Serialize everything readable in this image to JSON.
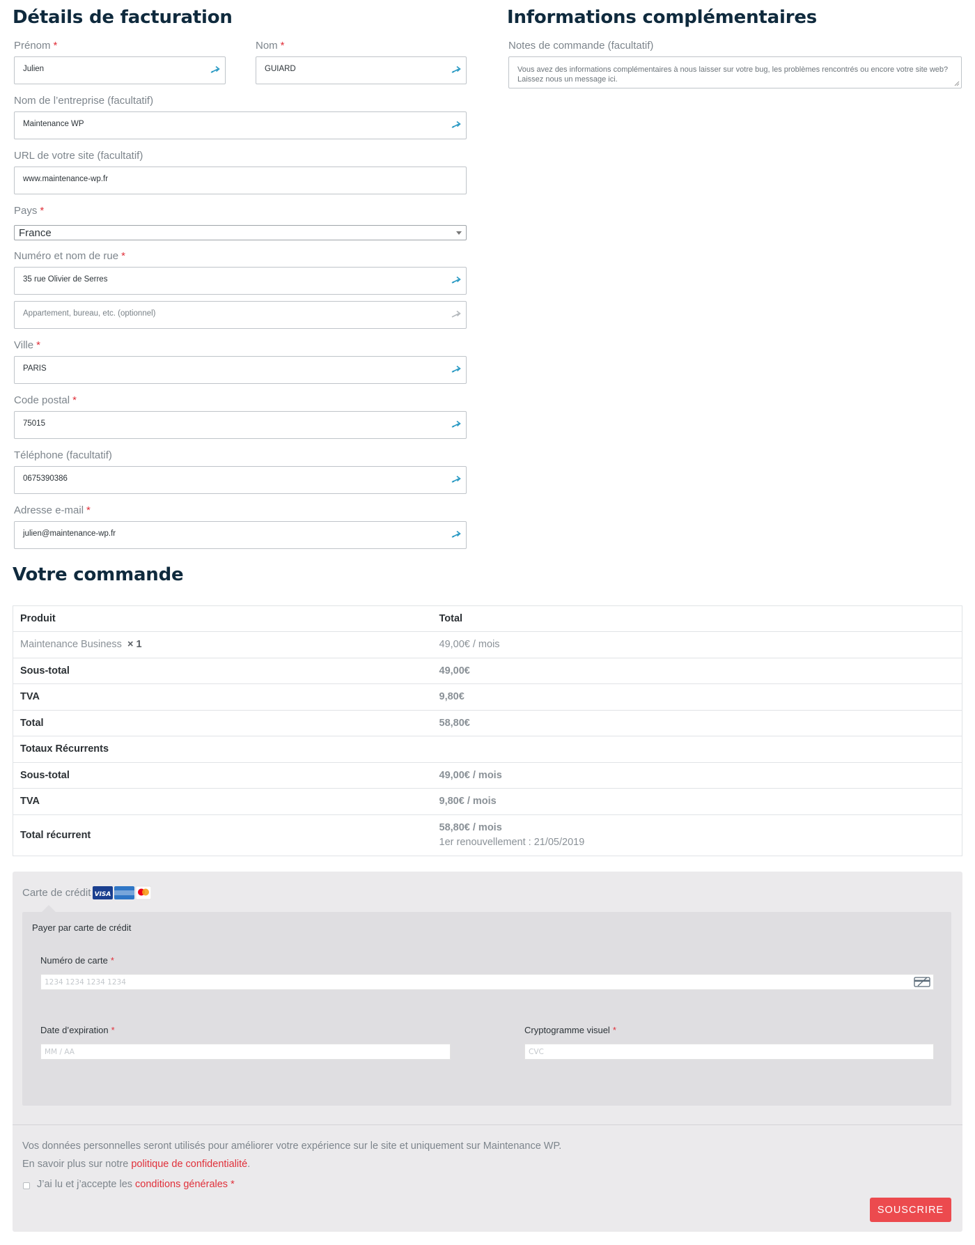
{
  "billing": {
    "title": "Détails de facturation",
    "first_name": {
      "label": "Prénom",
      "required": "*",
      "value": "Julien"
    },
    "last_name": {
      "label": "Nom",
      "required": "*",
      "value": "GUIARD"
    },
    "company": {
      "label": "Nom de l’entreprise (facultatif)",
      "value": "Maintenance WP"
    },
    "site_url": {
      "label": "URL de votre site (facultatif)",
      "value": "www.maintenance-wp.fr"
    },
    "country": {
      "label": "Pays",
      "required": "*",
      "value": "France"
    },
    "street": {
      "label": "Numéro et nom de rue",
      "required": "*",
      "value": "35 rue Olivier de Serres",
      "placeholder2": "Appartement, bureau, etc. (optionnel)"
    },
    "city": {
      "label": "Ville",
      "required": "*",
      "value": "PARIS"
    },
    "postcode": {
      "label": "Code postal",
      "required": "*",
      "value": "75015"
    },
    "phone": {
      "label": "Téléphone  (facultatif)",
      "value": "0675390386"
    },
    "email": {
      "label": "Adresse e-mail",
      "required": "*",
      "value": "julien@maintenance-wp.fr"
    },
    "autofill_icon": "autofill-key-icon"
  },
  "additional": {
    "title": "Informations complémentaires",
    "notes_label": "Notes de commande (facultatif)",
    "notes_placeholder_line1": "Vous avez des informations complémentaires à nous laisser sur votre bug, les problèmes rencontrés ou encore votre site web?",
    "notes_placeholder_line2": "Laissez nous un message ici."
  },
  "order": {
    "title": "Votre commande",
    "header": {
      "product": "Produit",
      "total": "Total"
    },
    "item": {
      "name": "Maintenance Business",
      "qty": "× 1",
      "price": "49,00€ / mois"
    },
    "subtotal": {
      "label": "Sous-total",
      "value": "49,00€"
    },
    "tax": {
      "label": "TVA",
      "value": "9,80€"
    },
    "total": {
      "label": "Total",
      "value": "58,80€"
    },
    "recurring_heading": "Totaux Récurrents",
    "recurring_subtotal": {
      "label": "Sous-total",
      "value": "49,00€ / mois"
    },
    "recurring_tax": {
      "label": "TVA",
      "value": "9,80€ / mois"
    },
    "recurring_total": {
      "label": "Total récurrent",
      "value": "58,80€ / mois",
      "renewal": "1er renouvellement : 21/05/2019"
    }
  },
  "payment": {
    "method_label": "Carte de crédit",
    "card_brands": [
      "VISA",
      "AMERICAN EXPRESS",
      "mastercard"
    ],
    "intro": "Payer par carte de crédit",
    "card_number": {
      "label": "Numéro de carte",
      "required": "*",
      "placeholder": "1234 1234 1234 1234"
    },
    "expiry": {
      "label": "Date d’expiration",
      "required": "*",
      "placeholder": "MM / AA"
    },
    "cvc": {
      "label": "Cryptogramme visuel",
      "required": "*",
      "placeholder": "CVC"
    }
  },
  "privacy": {
    "line1": "Vos données personnelles seront utilisés pour améliorer votre expérience sur le site et uniquement sur Maintenance WP.",
    "line2_prefix": "En savoir plus sur notre ",
    "line2_link": "politique de confidentialité",
    "line2_suffix": ".",
    "terms_prefix": "J’ai lu et j’accepte les ",
    "terms_link": "conditions générales",
    "terms_required": "*"
  },
  "submit_label": "SOUSCRIRE",
  "colors": {
    "accent": "#ec4a4e",
    "required": "#e0303a",
    "heading": "#0f2a3d",
    "autofill_icon": "#2a9ac4"
  }
}
